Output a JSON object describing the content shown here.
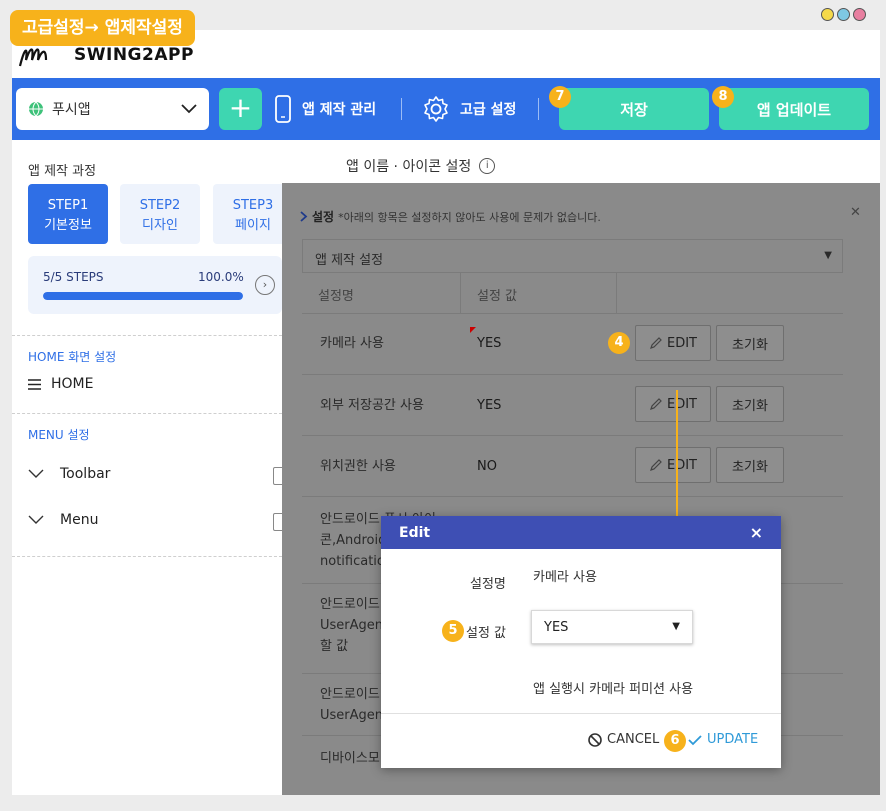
{
  "tag_label": "고급설정→ 앱제작설정",
  "window_dots": [
    "#f5d94a",
    "#7ec8e3",
    "#e87fa0"
  ],
  "logo": {
    "text": "SWING2APP"
  },
  "topbar": {
    "app_select": "푸시앱",
    "plus_label": "+",
    "nav_manage": "앱 제작 관리",
    "nav_advanced": "고급 설정",
    "save_label": "저장",
    "update_label": "앱 업데이트",
    "badge_save": "7",
    "badge_update": "8"
  },
  "sidebar": {
    "title": "앱 제작 과정",
    "steps": [
      {
        "line1": "STEP1",
        "line2": "기본정보",
        "active": true
      },
      {
        "line1": "STEP2",
        "line2": "디자인",
        "active": false
      },
      {
        "line1": "STEP3",
        "line2": "페이지",
        "active": false
      }
    ],
    "progress_label": "5/5 STEPS",
    "progress_pct": "100.0%",
    "progress_value": 1.0,
    "home_section": "HOME 화면 설정",
    "home_item": "HOME",
    "menu_section": "MENU 설정",
    "menu_items": [
      "Toolbar",
      "Menu"
    ]
  },
  "main": {
    "title": "앱 이름 · 아이콘 설정"
  },
  "panel": {
    "heading": "설정",
    "note": "*아래의 항목은 설정하지 않아도 사용에 문제가 없습니다.",
    "collapse_title": "앱 제작 설정",
    "col_name": "설정명",
    "col_value": "설정 값",
    "edit_label": "EDIT",
    "reset_label": "초기화",
    "badge_edit": "4",
    "rows": [
      {
        "name": [
          "카메라 사용"
        ],
        "value": "YES"
      },
      {
        "name": [
          "외부 저장공간 사용"
        ],
        "value": "YES"
      },
      {
        "name": [
          "위치권한 사용"
        ],
        "value": "NO"
      },
      {
        "name": [
          "안드로이드 푸시 아이",
          "콘,Android",
          "notification"
        ],
        "value": ""
      },
      {
        "name": [
          "안드로이드",
          "UserAgent",
          "할 값"
        ],
        "value": ""
      },
      {
        "name": [
          "안드로이드",
          "UserAgent"
        ],
        "value": ""
      },
      {
        "name": [
          "디바이스모"
        ],
        "value": ""
      }
    ]
  },
  "modal": {
    "title": "Edit",
    "close": "×",
    "label_name": "설정명",
    "value_name": "카메라 사용",
    "label_value": "설정 값",
    "select_value": "YES",
    "description": "앱 실행시 카메라 퍼미션 사용",
    "cancel_label": "CANCEL",
    "update_label": "UPDATE",
    "badge_value": "5",
    "badge_update": "6"
  }
}
